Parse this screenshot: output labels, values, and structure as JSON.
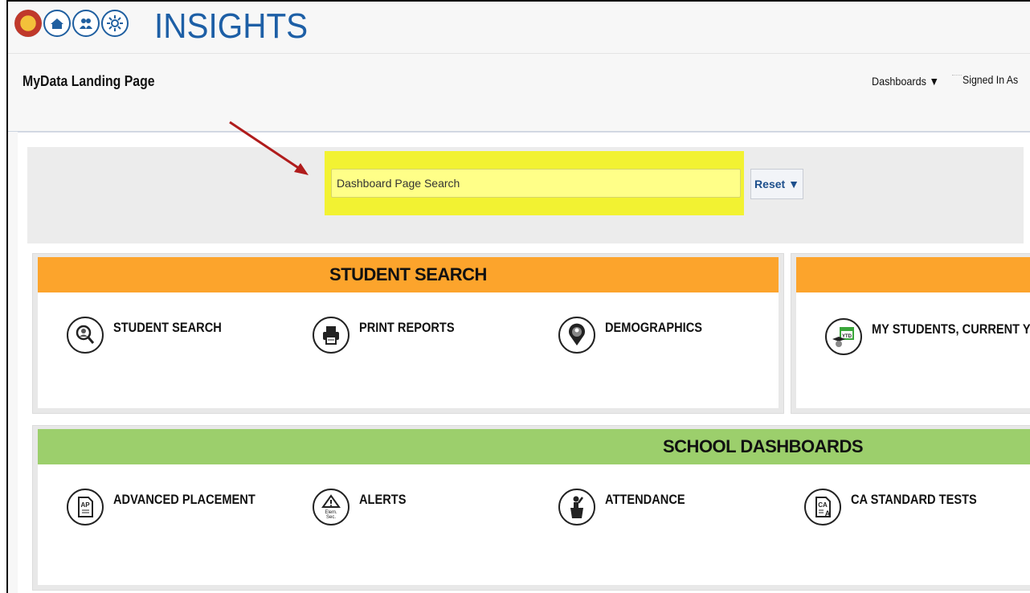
{
  "header": {
    "logo_text": "INSIGHTS",
    "logo_icons": [
      "district-seal-icon",
      "school-building-icon",
      "parents-icon",
      "sun-icon"
    ],
    "page_title": "MyData Landing Page",
    "dashboards_menu": "Dashboards ▼",
    "signed_in": "Signed In As"
  },
  "search": {
    "placeholder": "Dashboard Page Search",
    "reset_label": "Reset ▼"
  },
  "sections": [
    {
      "title": "STUDENT SEARCH",
      "color": "#fca42c",
      "tiles": [
        {
          "label": "STUDENT SEARCH",
          "icon": "student-magnifier-icon"
        },
        {
          "label": "PRINT REPORTS",
          "icon": "printer-icon"
        },
        {
          "label": "DEMOGRAPHICS",
          "icon": "map-pin-person-icon"
        }
      ]
    },
    {
      "title": "",
      "color": "#fca42c",
      "tiles": [
        {
          "label": "MY STUDENTS, CURRENT Y",
          "icon": "ytd-calendar-icon"
        }
      ]
    },
    {
      "title": "SCHOOL DASHBOARDS",
      "color": "#9ccf6c",
      "tiles": [
        {
          "label": "ADVANCED PLACEMENT",
          "icon": "ap-document-icon"
        },
        {
          "label": "ALERTS",
          "icon": "alert-elem-sec-icon"
        },
        {
          "label": "ATTENDANCE",
          "icon": "person-podium-icon"
        },
        {
          "label": "CA STANDARD TESTS",
          "icon": "ca-test-document-icon"
        }
      ]
    }
  ],
  "colors": {
    "brand_blue": "#1d5fa6",
    "highlight_yellow": "#f2f232",
    "annotation_arrow": "#b01c1c"
  }
}
